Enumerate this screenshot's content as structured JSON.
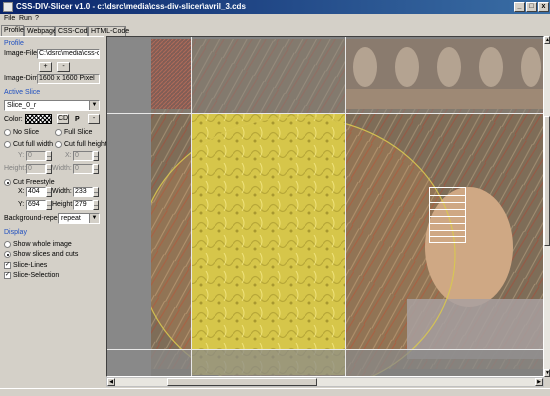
{
  "window": {
    "title": "CSS-DIV-Slicer v1.0 - c:\\dsrc\\media\\css-div-slicer\\avril_3.cds",
    "minimize": "_",
    "maximize": "□",
    "close": "x"
  },
  "menu": {
    "file": "File",
    "run": "Run",
    "help": "?"
  },
  "tabs": [
    "Profile",
    "Webpage",
    "CSS-Code",
    "HTML-Code"
  ],
  "profile": {
    "section": "Profile",
    "image_file_label": "Image-File:",
    "image_file_value": "C:\\dsrc\\media\\css-div-",
    "add_label": "+",
    "remove_label": "-",
    "image_dim_label": "Image-Dim:",
    "image_dim_value": "1600 x 1600 Pixel"
  },
  "active_slice": {
    "section": "Active Slice",
    "selected": "Slice_0_r",
    "color_label": "Color:",
    "cd_label": "CD",
    "p_label": "P",
    "minus_label": "-",
    "no_slice": "No Slice",
    "full_slice": "Full Slice",
    "cut_full_width": "Cut full width",
    "cut_full_height": "Cut full height",
    "y_label": "Y:",
    "x_label": "X:",
    "height_label": "Height:",
    "width_label": "Width:",
    "cut_y_value": "0",
    "cut_x_value": "0",
    "cut_height_value": "0",
    "cut_width_value": "0",
    "cut_freestyle": "Cut Freestyle",
    "free_x_label": "X:",
    "free_x_value": "404",
    "free_width_label": "Width:",
    "free_width_value": "233",
    "free_y_label": "Y:",
    "free_y_value": "694",
    "free_height_label": "Height:",
    "free_height_value": "279",
    "bg_repeat_label": "Background-repeat:",
    "bg_repeat_value": "repeat"
  },
  "display": {
    "section": "Display",
    "show_whole_image": "Show whole image",
    "show_slices_cuts": "Show slices and cuts",
    "slice_lines": "Slice-Lines",
    "slice_selection": "Slice-Selection"
  },
  "colors": {
    "accent_blue": "#2050c0",
    "title_start": "#0a246a",
    "title_end": "#3a6ea5",
    "slice_yellow": "#d8c850"
  }
}
